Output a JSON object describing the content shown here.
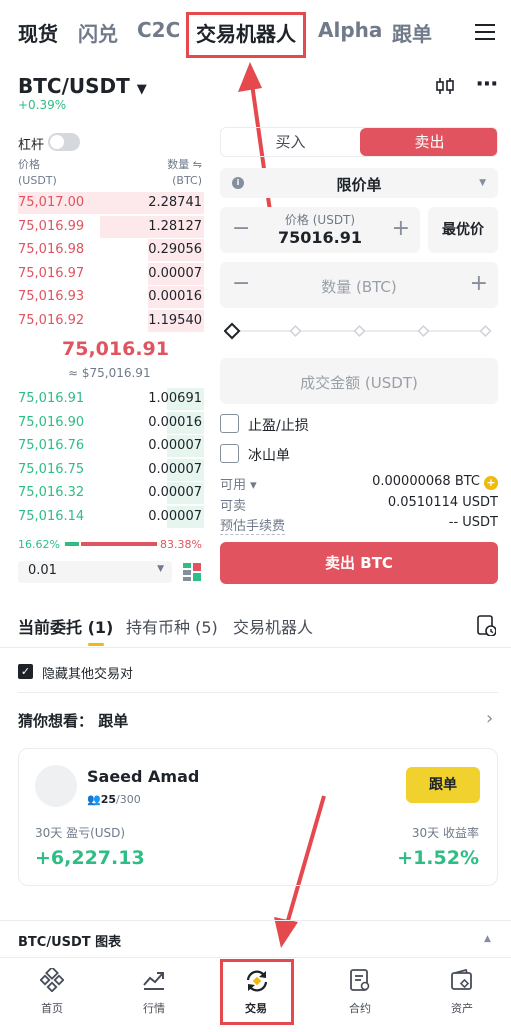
{
  "top_tabs": [
    {
      "label": "现货",
      "active": true
    },
    {
      "label": "闪兑"
    },
    {
      "label": "C2C"
    },
    {
      "label": "交易机器人"
    },
    {
      "label": "Alpha"
    },
    {
      "label": "跟单"
    }
  ],
  "pair": {
    "symbol": "BTC/USDT",
    "change": "+0.39%"
  },
  "orderbook": {
    "leverage_label": "杠杆",
    "price_header": "价格",
    "price_unit": "(USDT)",
    "qty_header": "数量 ⇋",
    "qty_unit": "(BTC)",
    "asks": [
      {
        "price": "75,017.00",
        "qty": "2.28741",
        "depth": 1.0
      },
      {
        "price": "75,016.99",
        "qty": "1.28127",
        "depth": 0.56
      },
      {
        "price": "75,016.98",
        "qty": "0.29056",
        "depth": 0.3
      },
      {
        "price": "75,016.97",
        "qty": "0.00007",
        "depth": 0.3
      },
      {
        "price": "75,016.93",
        "qty": "0.00016",
        "depth": 0.3
      },
      {
        "price": "75,016.92",
        "qty": "1.19540",
        "depth": 0.3
      }
    ],
    "mid_price": "75,016.91",
    "mid_usd": "≈ $75,016.91",
    "bids": [
      {
        "price": "75,016.91",
        "qty": "1.00691",
        "depth": 0.2
      },
      {
        "price": "75,016.90",
        "qty": "0.00016",
        "depth": 0.2
      },
      {
        "price": "75,016.76",
        "qty": "0.00007",
        "depth": 0.2
      },
      {
        "price": "75,016.75",
        "qty": "0.00007",
        "depth": 0.2
      },
      {
        "price": "75,016.32",
        "qty": "0.00007",
        "depth": 0.2
      },
      {
        "price": "75,016.14",
        "qty": "0.00007",
        "depth": 0.2
      }
    ],
    "buy_ratio": "16.62%",
    "sell_ratio": "83.38%",
    "buy_fraction": 0.1662,
    "depth_step": "0.01"
  },
  "form": {
    "buy_tab": "买入",
    "sell_tab": "卖出",
    "order_type": "限价单",
    "price_label": "价格 (USDT)",
    "price_value": "75016.91",
    "best_price": "最优价",
    "qty_placeholder": "数量 (BTC)",
    "amount_placeholder": "成交金额 (USDT)",
    "tp_sl": "止盈/止损",
    "iceberg": "冰山单",
    "available_label": "可用 ▾",
    "available_value": "0.00000068 BTC",
    "sellable_label": "可卖",
    "sellable_value": "0.0510114 USDT",
    "fee_label": "预估手续费",
    "fee_value": "-- USDT",
    "submit": "卖出 BTC"
  },
  "orders_tabs": [
    {
      "label": "当前委托 (1)",
      "active": true
    },
    {
      "label": "持有币种 (5)"
    },
    {
      "label": "交易机器人"
    }
  ],
  "hide_other_pairs": "隐藏其他交易对",
  "guess": "猜你想看：  跟单",
  "copy_card": {
    "name": "Saeed Amad",
    "followers": "25",
    "followers_max": "/300",
    "follow_btn": "跟单",
    "pnl_label": "30天 盈亏(USD)",
    "pnl_value": "+6,227.13",
    "roi_label": "30天 收益率",
    "roi_value": "+1.52%"
  },
  "chart_section": "BTC/USDT 图表",
  "bottom_nav": [
    {
      "label": "首页",
      "icon": "home-icon"
    },
    {
      "label": "行情",
      "icon": "markets-icon"
    },
    {
      "label": "交易",
      "icon": "trade-icon",
      "active": true
    },
    {
      "label": "合约",
      "icon": "futures-icon"
    },
    {
      "label": "资产",
      "icon": "wallet-icon"
    }
  ],
  "colors": {
    "sell": "#e0535f",
    "buy": "#2ebd85",
    "accent": "#f0b90b",
    "annotation": "#e5484d"
  }
}
